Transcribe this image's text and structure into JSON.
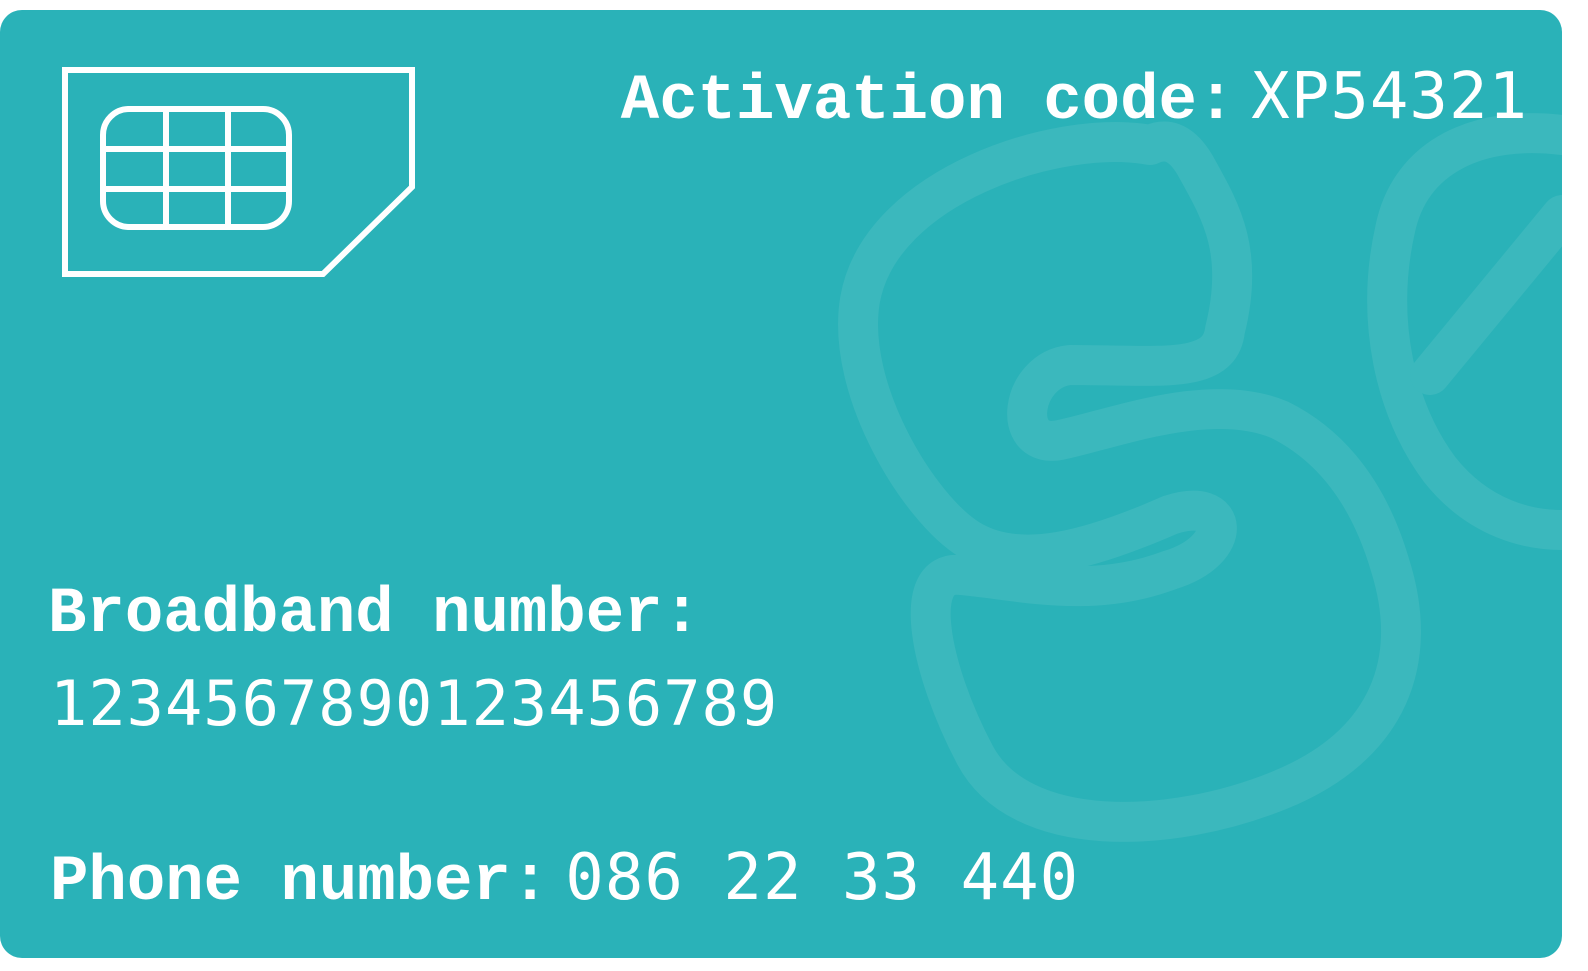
{
  "card": {
    "background_color": "#2ab2b8",
    "foreground_color": "#ffffff",
    "watermark_color": "#3bb8bd",
    "icon": "sim-card-chip-icon"
  },
  "activation": {
    "label": "Activation code:",
    "value": "XP54321"
  },
  "broadband": {
    "label": "Broadband number:",
    "value": "1234567890123456789"
  },
  "phone": {
    "label": "Phone number:",
    "value": "086 22 33 440"
  }
}
